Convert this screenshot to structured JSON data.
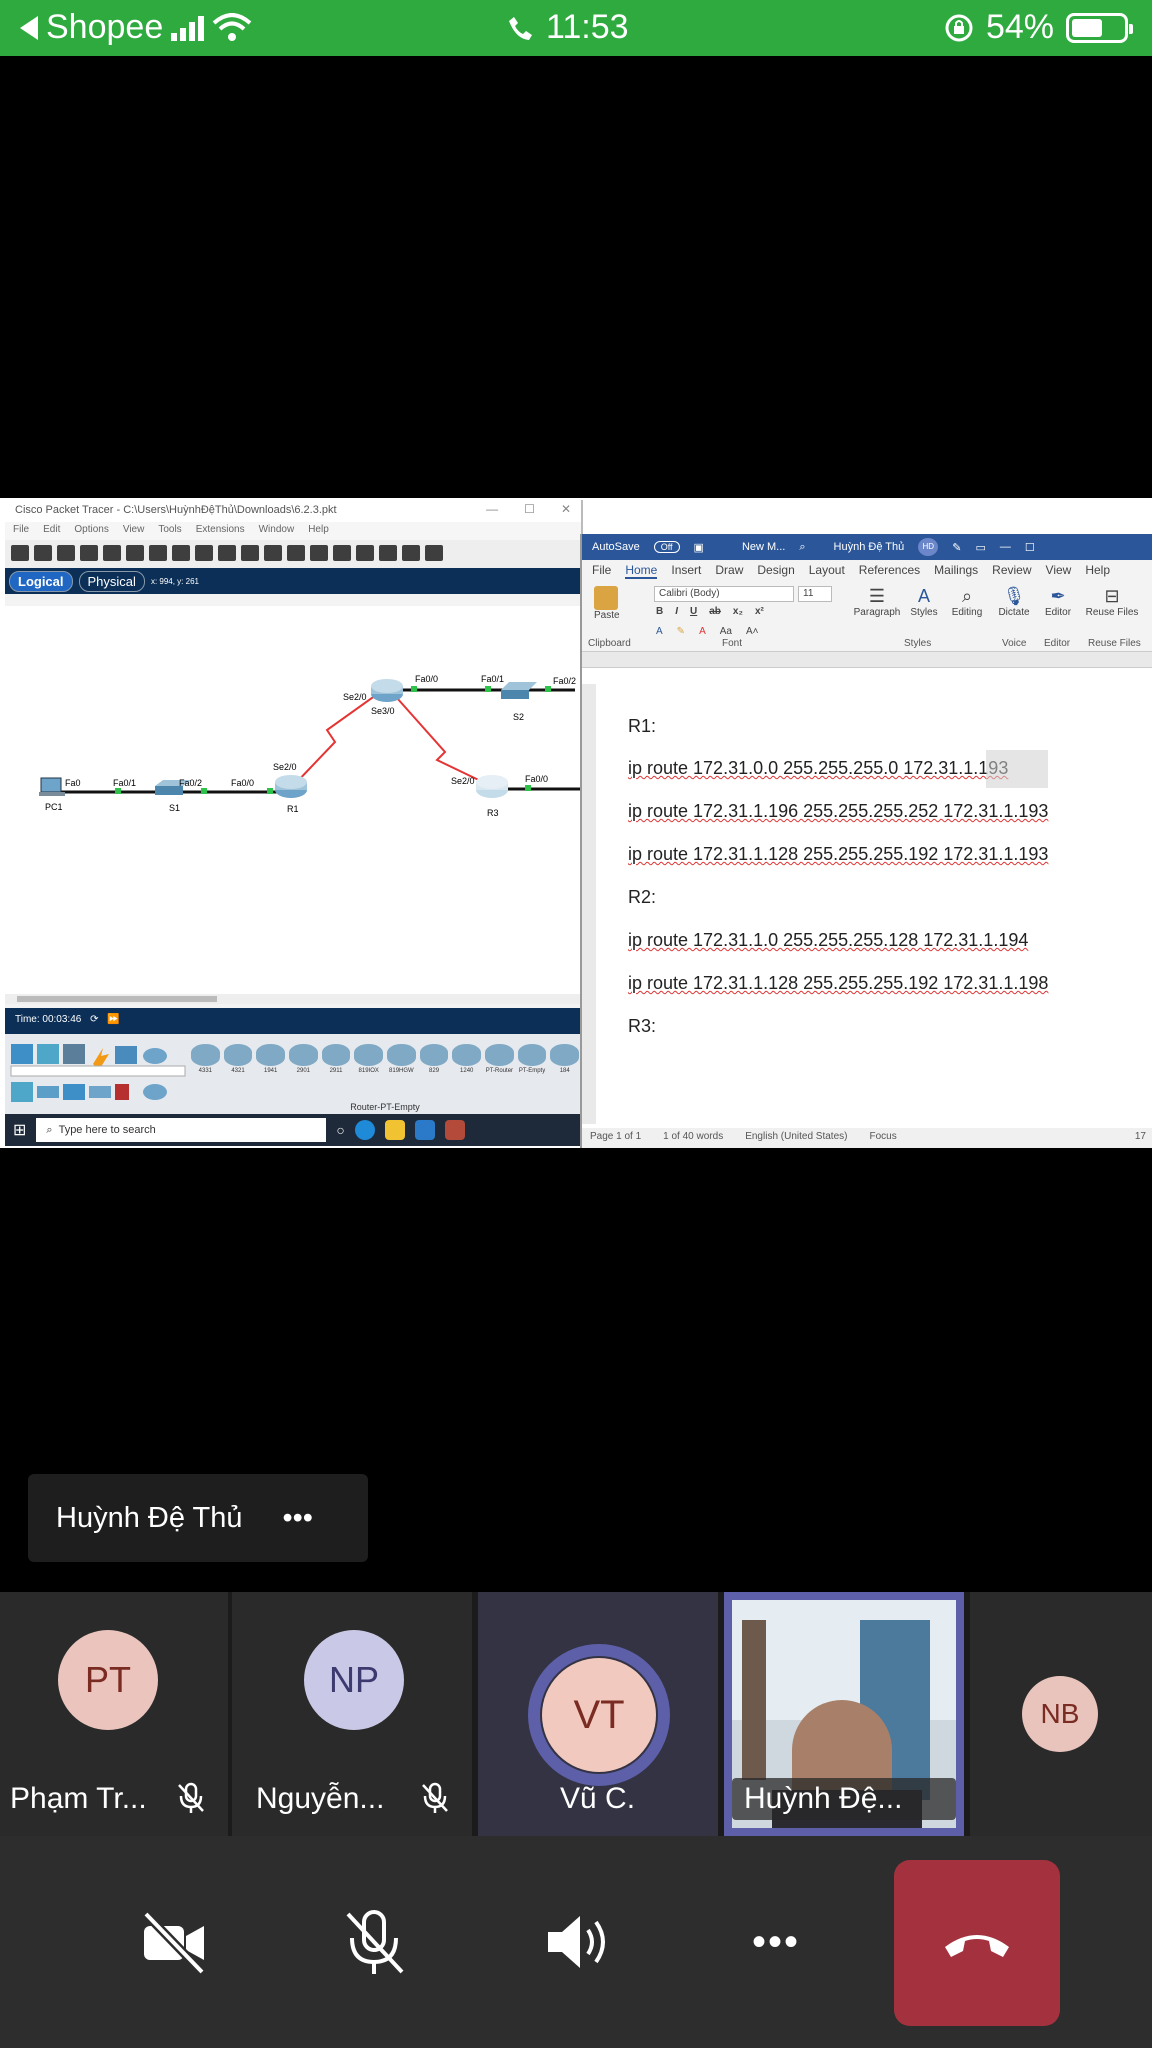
{
  "status_bar": {
    "back_app": "Shopee",
    "time": "11:53",
    "battery": "54%",
    "battery_level": 0.54
  },
  "packet_tracer": {
    "title": "Cisco Packet Tracer - C:\\Users\\HuỳnhĐệThủ\\Downloads\\6.2.3.pkt",
    "menu": [
      "File",
      "Edit",
      "Options",
      "View",
      "Tools",
      "Extensions",
      "Window",
      "Help"
    ],
    "tabs": [
      "Logical",
      "Physical"
    ],
    "coords": "x: 994, y: 261",
    "time": "Time: 00:03:46",
    "device_models": [
      "4331",
      "4321",
      "1941",
      "2901",
      "2911",
      "819IOX",
      "819HGW",
      "829",
      "1240",
      "PT-Router",
      "PT-Empty",
      "184"
    ],
    "selected_device": "Router-PT-Empty",
    "search_placeholder": "Type here to search",
    "topology": {
      "nodes": {
        "pc1": "PC1",
        "s1": "S1",
        "r1": "R1",
        "r2_label": "",
        "s2": "S2",
        "r3": "R3"
      },
      "ports": {
        "pc1_fa0": "Fa0",
        "s1_fa01": "Fa0/1",
        "s1_fa02": "Fa0/2",
        "r1_fa00": "Fa0/0",
        "r1_se20": "Se2/0",
        "r2_se20": "Se2/0",
        "r2_se30": "Se3/0",
        "r2_fa00": "Fa0/0",
        "s2_fa01": "Fa0/1",
        "s2_fa02": "Fa0/2",
        "r3_se20": "Se2/0",
        "r3_fa00": "Fa0/0"
      }
    }
  },
  "word": {
    "autosave": "AutoSave",
    "autosave_state": "Off",
    "doc_name": "New M...",
    "user": "Huỳnh Đệ Thủ",
    "user_initials": "HD",
    "tabs": [
      "File",
      "Home",
      "Insert",
      "Draw",
      "Design",
      "Layout",
      "References",
      "Mailings",
      "Review",
      "View",
      "Help"
    ],
    "font_name": "Calibri (Body)",
    "font_size": "11",
    "ribbon_groups": [
      "Clipboard",
      "Font",
      "Paragraph",
      "Styles",
      "Editing",
      "Dictate",
      "Editor",
      "Reuse Files",
      "Voice"
    ],
    "ribbon_labels": {
      "paste": "Paste",
      "styles_group": "Styles",
      "voice_group": "Voice",
      "editor_group": "Editor",
      "reuse_group": "Reuse Files"
    },
    "document_lines": [
      "R1:",
      "ip route 172.31.0.0 255.255.255.0 172.31.1.193",
      "ip route 172.31.1.196 255.255.255.252 172.31.1.193",
      "ip route 172.31.1.128 255.255.255.192 172.31.1.193",
      "R2:",
      "ip route 172.31.1.0 255.255.255.128 172.31.1.194",
      "ip route 172.31.1.128 255.255.255.192 172.31.1.198",
      "R3:"
    ],
    "status": {
      "page": "Page 1 of 1",
      "words": "1 of 40 words",
      "lang": "English (United States)",
      "focus": "Focus",
      "zoom": "17"
    }
  },
  "presenter_tag": {
    "name": "Huỳnh Đệ Thủ",
    "more": "•••"
  },
  "participants": [
    {
      "initials": "PT",
      "name": "Phạm Tr...",
      "muted": true,
      "avatar_bg": "#eac4bd",
      "avatar_fg": "#7a2b22"
    },
    {
      "initials": "NP",
      "name": "Nguyễn...",
      "muted": true,
      "avatar_bg": "#c9c8e6",
      "avatar_fg": "#3c3a6e"
    },
    {
      "initials": "VT",
      "name": "Vũ C.",
      "muted": false,
      "speaking": true,
      "avatar_bg": "#f1c9bf",
      "avatar_fg": "#7a2b22"
    },
    {
      "initials": "",
      "name": "Huỳnh Đệ...",
      "muted": false,
      "video": true
    },
    {
      "initials": "NB",
      "name": "",
      "muted": false,
      "avatar_bg": "#e8c4bd",
      "avatar_fg": "#7a2b22"
    }
  ],
  "call_controls": [
    "camera-off",
    "mic-off",
    "speaker",
    "more",
    "hang-up"
  ],
  "more_label": "•••",
  "colors": {
    "status_green": "#2eaa3f",
    "hangup_red": "#a4323e",
    "word_blue": "#2b579a",
    "speaker_ring": "#5d5fa8"
  }
}
